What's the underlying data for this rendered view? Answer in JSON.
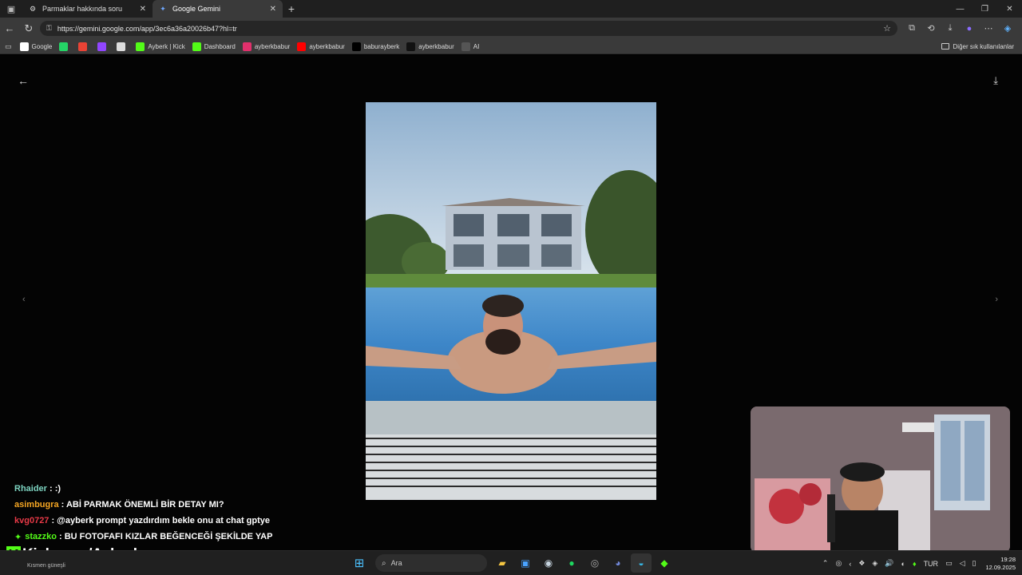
{
  "browser": {
    "tabs": [
      {
        "label": "Parmaklar hakkında soru",
        "active": false
      },
      {
        "label": "Google Gemini",
        "active": true
      }
    ],
    "url": "https://gemini.google.com/app/3ec6a36a20026b47?hl=tr",
    "bookmarks": [
      {
        "label": "Google",
        "icon": "google-icon",
        "color": "#ffffff"
      },
      {
        "label": "",
        "icon": "whatsapp-icon",
        "color": "#25d366"
      },
      {
        "label": "",
        "icon": "gmail-icon",
        "color": "#ea4335"
      },
      {
        "label": "",
        "icon": "twitch-icon",
        "color": "#9146ff"
      },
      {
        "label": "",
        "icon": "diamond-icon",
        "color": "#dddddd"
      },
      {
        "label": "Ayberk | Kick",
        "icon": "kick-icon",
        "color": "#53fc18"
      },
      {
        "label": "Dashboard",
        "icon": "kick-icon",
        "color": "#53fc18"
      },
      {
        "label": "ayberkbabur",
        "icon": "instagram-icon",
        "color": "#e1306c"
      },
      {
        "label": "ayberkbabur",
        "icon": "youtube-icon",
        "color": "#ff0000"
      },
      {
        "label": "baburayberk",
        "icon": "x-icon",
        "color": "#000000"
      },
      {
        "label": "ayberkbabur",
        "icon": "tiktok-icon",
        "color": "#111111"
      },
      {
        "label": "AI",
        "icon": "openai-icon",
        "color": "#555555"
      }
    ],
    "other_bookmarks": "Diğer sık kullanılanlar"
  },
  "chat": [
    {
      "user": "Rhaider",
      "color": "#7dd3c0",
      "message": ": :)",
      "badge": false
    },
    {
      "user": "asimbugra",
      "color": "#f5a623",
      "message": ": ABİ PARMAK ÖNEMLİ BİR DETAY MI?",
      "badge": false
    },
    {
      "user": "kvg0727",
      "color": "#e63946",
      "message": ": @ayberk prompt yazdırdım bekle onu at chat gptye",
      "badge": false
    },
    {
      "user": "stazzko",
      "color": "#53fc18",
      "message": ": BU FOTOFAFI KIZLAR BEĞENCEĞİ ŞEKİLDE YAP",
      "badge": true
    }
  ],
  "overlay": {
    "brand": "Kick.com/Ayberk",
    "brand_color": "#53fc18"
  },
  "taskbar": {
    "weather": "Kısmen güneşli",
    "search_placeholder": "Ara",
    "language": "TUR",
    "time": "19:28",
    "date": "12.09.2025"
  }
}
